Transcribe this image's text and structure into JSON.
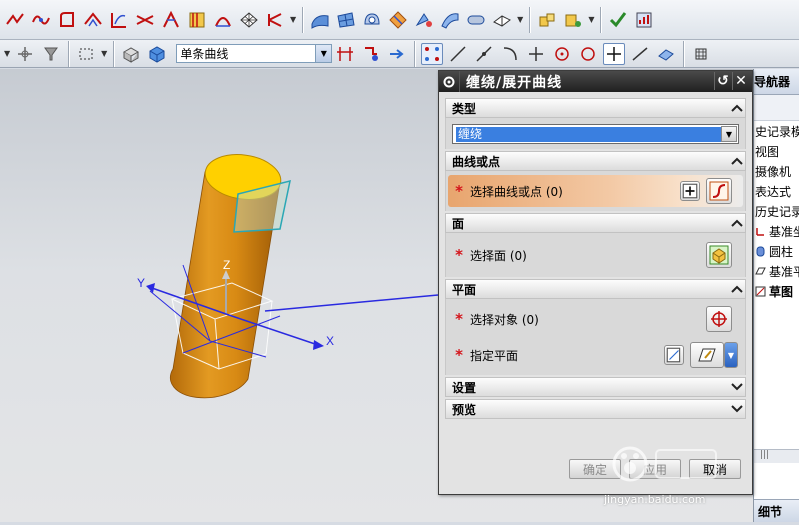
{
  "toolbar2": {
    "curve_filter": "单条曲线"
  },
  "dialog": {
    "title": "缠绕/展开曲线",
    "sections": {
      "type": {
        "header": "类型",
        "value": "缠绕"
      },
      "curve": {
        "header": "曲线或点",
        "select_label": "选择曲线或点 (0)"
      },
      "face": {
        "header": "面",
        "select_label": "选择面 (0)"
      },
      "plane": {
        "header": "平面",
        "object_label": "选择对象 (0)",
        "plane_label": "指定平面"
      },
      "settings": {
        "header": "设置"
      },
      "preview": {
        "header": "预览"
      }
    },
    "buttons": {
      "ok": "确定",
      "apply": "应用",
      "cancel": "取消"
    }
  },
  "viewport": {
    "axis_z": "Z",
    "axis_y": "Y",
    "axis_x": "X",
    "colors": {
      "cylinder": "#d98a12",
      "cylinder_top": "#ffd000",
      "axis": "#1a1aff",
      "plane": "#2aa7b5"
    }
  },
  "navigator": {
    "title": "导航器",
    "items": [
      "史记录模式",
      "视图",
      "摄像机",
      "表达式",
      "历史记录",
      "基准坐",
      "圆柱",
      "基准平",
      "草图"
    ],
    "footer": "细节"
  },
  "watermark": {
    "text": "jingyan.baidu.com"
  }
}
